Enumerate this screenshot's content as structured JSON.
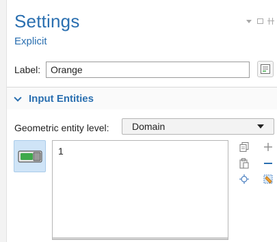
{
  "header": {
    "title": "Settings",
    "subtitle": "Explicit"
  },
  "label_row": {
    "label": "Label:",
    "value": "Orange"
  },
  "section": {
    "title": "Input Entities"
  },
  "geometric_level": {
    "label": "Geometric entity level:",
    "selected": "Domain"
  },
  "selection_list": {
    "items": [
      "1"
    ]
  },
  "icons": {
    "window_menu": "dropdown-icon",
    "window_max": "maximize-icon",
    "window_pin": "pin-icon",
    "label_action": "label-edit-icon",
    "toggle": "active-toggle-icon",
    "copy": "copy-icon",
    "paste": "paste-icon",
    "zoom": "zoom-to-selection-icon",
    "add": "add-icon",
    "remove": "remove-icon",
    "clear": "clear-selection-icon"
  },
  "colors": {
    "accent": "#2a6fb0",
    "toggle_bg": "#cfe4f7",
    "toggle_on": "#3fa94b"
  }
}
